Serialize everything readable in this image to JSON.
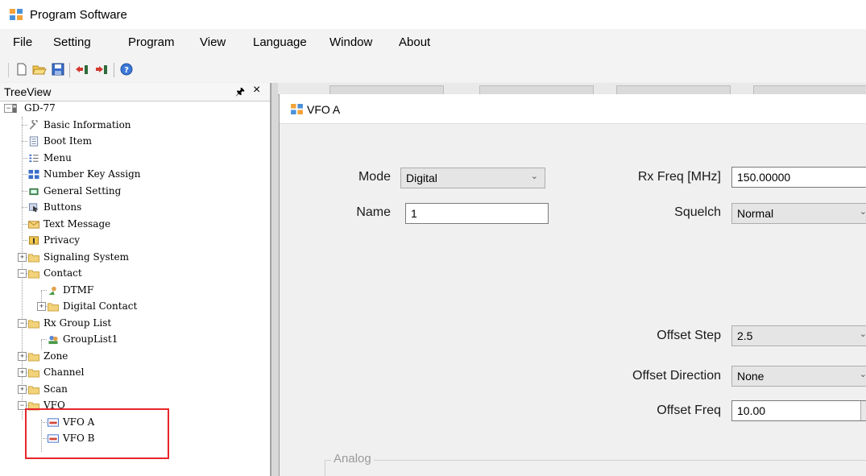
{
  "window": {
    "title": "Program Software"
  },
  "menu": [
    "File",
    "Setting",
    "Program",
    "View",
    "Language",
    "Window",
    "About"
  ],
  "toolbar": {
    "icons": [
      "new-file-icon",
      "open-folder-icon",
      "save-icon",
      "read-from-radio-icon",
      "write-to-radio-icon",
      "help-icon"
    ]
  },
  "tree": {
    "title": "TreeView",
    "pin": "p",
    "close": "×",
    "nodes": [
      {
        "label": "GD-77",
        "icon": "radio-icon"
      },
      {
        "label": "Basic Information",
        "icon": "wrench-icon"
      },
      {
        "label": "Boot Item",
        "icon": "document-icon"
      },
      {
        "label": "Menu",
        "icon": "menu-list-icon"
      },
      {
        "label": "Number Key Assign",
        "icon": "keypad-icon"
      },
      {
        "label": "General Setting",
        "icon": "settings-icon"
      },
      {
        "label": "Buttons",
        "icon": "cursor-icon"
      },
      {
        "label": "Text Message",
        "icon": "envelope-icon"
      },
      {
        "label": "Privacy",
        "icon": "filter-icon"
      },
      {
        "label": "Signaling System",
        "icon": "folder-icon"
      },
      {
        "label": "Contact",
        "icon": "folder-icon"
      },
      {
        "label": "DTMF",
        "icon": "person-icon"
      },
      {
        "label": "Digital Contact",
        "icon": "folder-icon"
      },
      {
        "label": "Rx Group List",
        "icon": "folder-icon"
      },
      {
        "label": "GroupList1",
        "icon": "group-icon"
      },
      {
        "label": "Zone",
        "icon": "folder-icon"
      },
      {
        "label": "Channel",
        "icon": "folder-icon"
      },
      {
        "label": "Scan",
        "icon": "folder-icon"
      },
      {
        "label": "VFO",
        "icon": "folder-icon"
      },
      {
        "label": "VFO A",
        "icon": "vfo-icon"
      },
      {
        "label": "VFO B",
        "icon": "vfo-icon"
      }
    ]
  },
  "vfo": {
    "title": "VFO A",
    "mode_label": "Mode",
    "mode_value": "Digital",
    "name_label": "Name",
    "name_value": "1",
    "rx_freq_label": "Rx Freq [MHz]",
    "rx_freq_value": "150.00000",
    "squelch_label": "Squelch",
    "squelch_value": "Normal",
    "offset_step_label": "Offset Step",
    "offset_step_value": "2.5",
    "offset_direction_label": "Offset Direction",
    "offset_direction_value": "None",
    "offset_freq_label": "Offset Freq",
    "offset_freq_value": "10.00",
    "analog_group_label": "Analog"
  },
  "colors": {
    "highlight": "#e8262b",
    "folder": "#f2c94c"
  }
}
